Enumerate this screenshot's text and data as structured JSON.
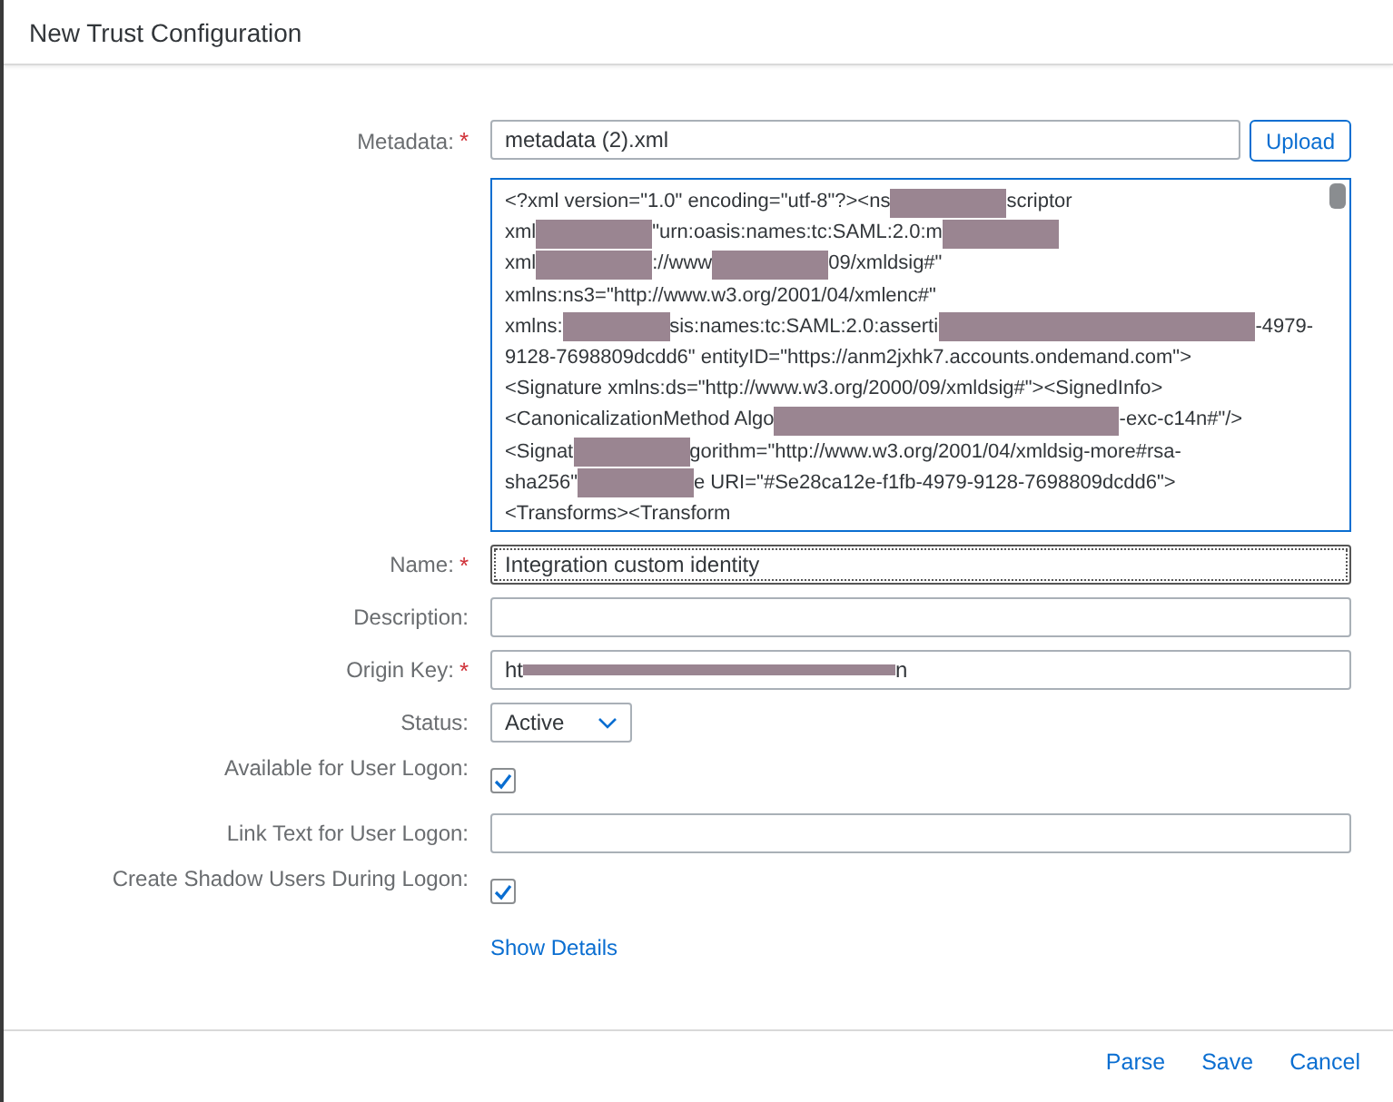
{
  "window": {
    "title": "New Trust Configuration"
  },
  "form": [
    {
      "kind": "file",
      "label": "Metadata:",
      "required": "*",
      "value": "metadata (2).xml",
      "button": "Upload"
    },
    {
      "kind": "xml",
      "lines": [
        [
          {
            "text": "<?xml version=\"1.0\" encoding=\"utf-8\"?><ns"
          },
          {
            "kind": "redacted"
          },
          {
            "text": "scriptor"
          }
        ],
        [
          {
            "text": "xml"
          },
          {
            "kind": "redacted"
          },
          {
            "text": "\"urn:oasis:names:tc:SAML:2.0:m"
          },
          {
            "kind": "redacted"
          }
        ],
        [
          {
            "text": "xml"
          },
          {
            "kind": "redacted"
          },
          {
            "text": "://www"
          },
          {
            "kind": "redacted"
          },
          {
            "text": "09/xmldsig#\""
          }
        ],
        [
          {
            "text": "xmlns:ns3=\"http://www.w3.org/2001/04/xmlenc#\""
          }
        ],
        [
          {
            "text": "xmlns:"
          },
          {
            "kind": "redacted"
          },
          {
            "text": "sis:names:tc:SAML:2.0:asserti"
          },
          {
            "kind": "redacted-long"
          },
          {
            "text": "-4979-"
          }
        ],
        [
          {
            "text": "9128-7698809dcdd6\" entityID=\"https://anm2jxhk7.accounts.ondemand.com\">"
          }
        ],
        [
          {
            "text": "<Signature xmlns:ds=\"http://www.w3.org/2000/09/xmldsig#\"><SignedInfo>"
          }
        ],
        [
          {
            "text": "<CanonicalizationMethod Algo"
          },
          {
            "kind": "redacted-long"
          },
          {
            "text": "-exc-c14n#\"/>"
          }
        ],
        [
          {
            "text": "<Signat"
          },
          {
            "kind": "redacted"
          },
          {
            "text": "gorithm=\"http://www.w3.org/2001/04/xmldsig-more#rsa-"
          }
        ],
        [
          {
            "text": "sha256\""
          },
          {
            "kind": "redacted"
          },
          {
            "text": "e URI=\"#Se28ca12e-f1fb-4979-9128-7698809dcdd6\">"
          }
        ],
        [
          {
            "text": "<Transforms><Transform"
          }
        ]
      ]
    },
    {
      "kind": "text",
      "label": "Name:",
      "required": "*",
      "focused": true,
      "segments": [
        {
          "text": "Integration custom identity"
        }
      ]
    },
    {
      "kind": "text",
      "label": "Description:",
      "focused": false
    },
    {
      "kind": "text",
      "label": "Origin Key:",
      "required": "*",
      "focused": false,
      "segments": [
        {
          "text": "ht"
        },
        {
          "kind": "strike"
        },
        {
          "text": "n"
        }
      ]
    },
    {
      "kind": "select",
      "label": "Status:",
      "value": "Active"
    },
    {
      "kind": "checkbox",
      "label": "Available for User Logon:",
      "checked": true
    },
    {
      "kind": "text",
      "label": "Link Text for User Logon:",
      "focused": false
    },
    {
      "kind": "checkbox",
      "label": "Create Shadow Users During Logon:",
      "checked": true
    },
    {
      "kind": "link",
      "label": "Show Details"
    }
  ],
  "footer": {
    "buttons": [
      "Parse",
      "Save",
      "Cancel"
    ]
  }
}
